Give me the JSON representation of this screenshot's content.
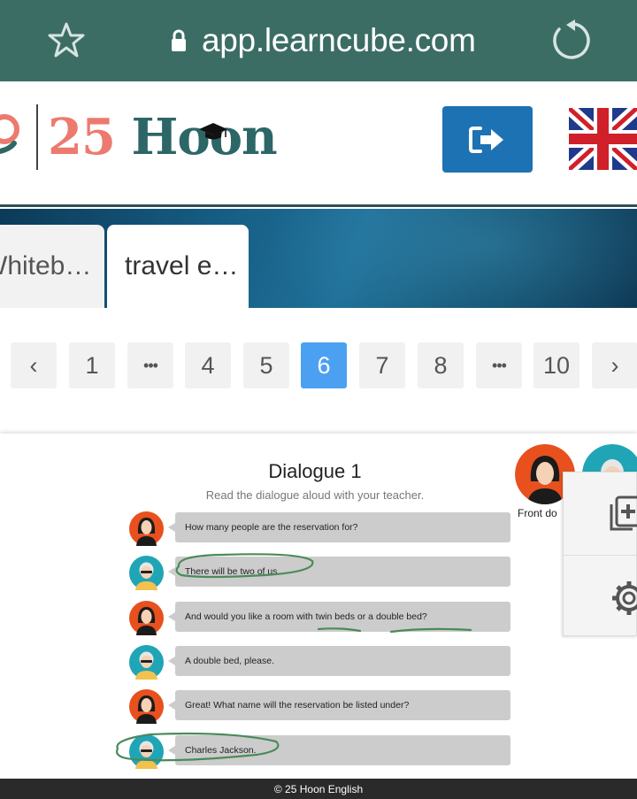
{
  "browser": {
    "url": "app.learncube.com"
  },
  "header": {
    "logo_number": "25",
    "logo_word": "Hoon",
    "accent_color": "#ec7a6e",
    "brand_color": "#2d6666",
    "login_icon": "sign-in-arrow-icon",
    "flag_icon": "uk-flag-icon"
  },
  "tabs": [
    {
      "label": "Whiteb…"
    },
    {
      "label": "travel e…"
    }
  ],
  "pagination": {
    "items": [
      "‹",
      "1",
      "•••",
      "4",
      "5",
      "6",
      "7",
      "8",
      "•••",
      "10",
      "›"
    ],
    "current": "6",
    "active_color": "#4ca0f2"
  },
  "slide": {
    "title": "Dialogue 1",
    "subtitle": "Read the dialogue aloud with your teacher.",
    "lines": [
      {
        "speaker": "front-desk",
        "text": "How many people are the reservation for?"
      },
      {
        "speaker": "guest",
        "text": "There will be two of us."
      },
      {
        "speaker": "front-desk",
        "text": "And would you like a room with twin beds or a double bed?"
      },
      {
        "speaker": "guest",
        "text": "A double bed, please."
      },
      {
        "speaker": "front-desk",
        "text": "Great! What name will the reservation be listed under?"
      },
      {
        "speaker": "guest",
        "text": "Charles Jackson."
      }
    ],
    "annotation_color": "#4a8a5a"
  },
  "participants": {
    "label": "Front do"
  },
  "side_panel": {
    "icons": [
      "add-slide-icon",
      "gear-icon"
    ]
  },
  "footer": {
    "text": "© 25 Hoon English"
  }
}
